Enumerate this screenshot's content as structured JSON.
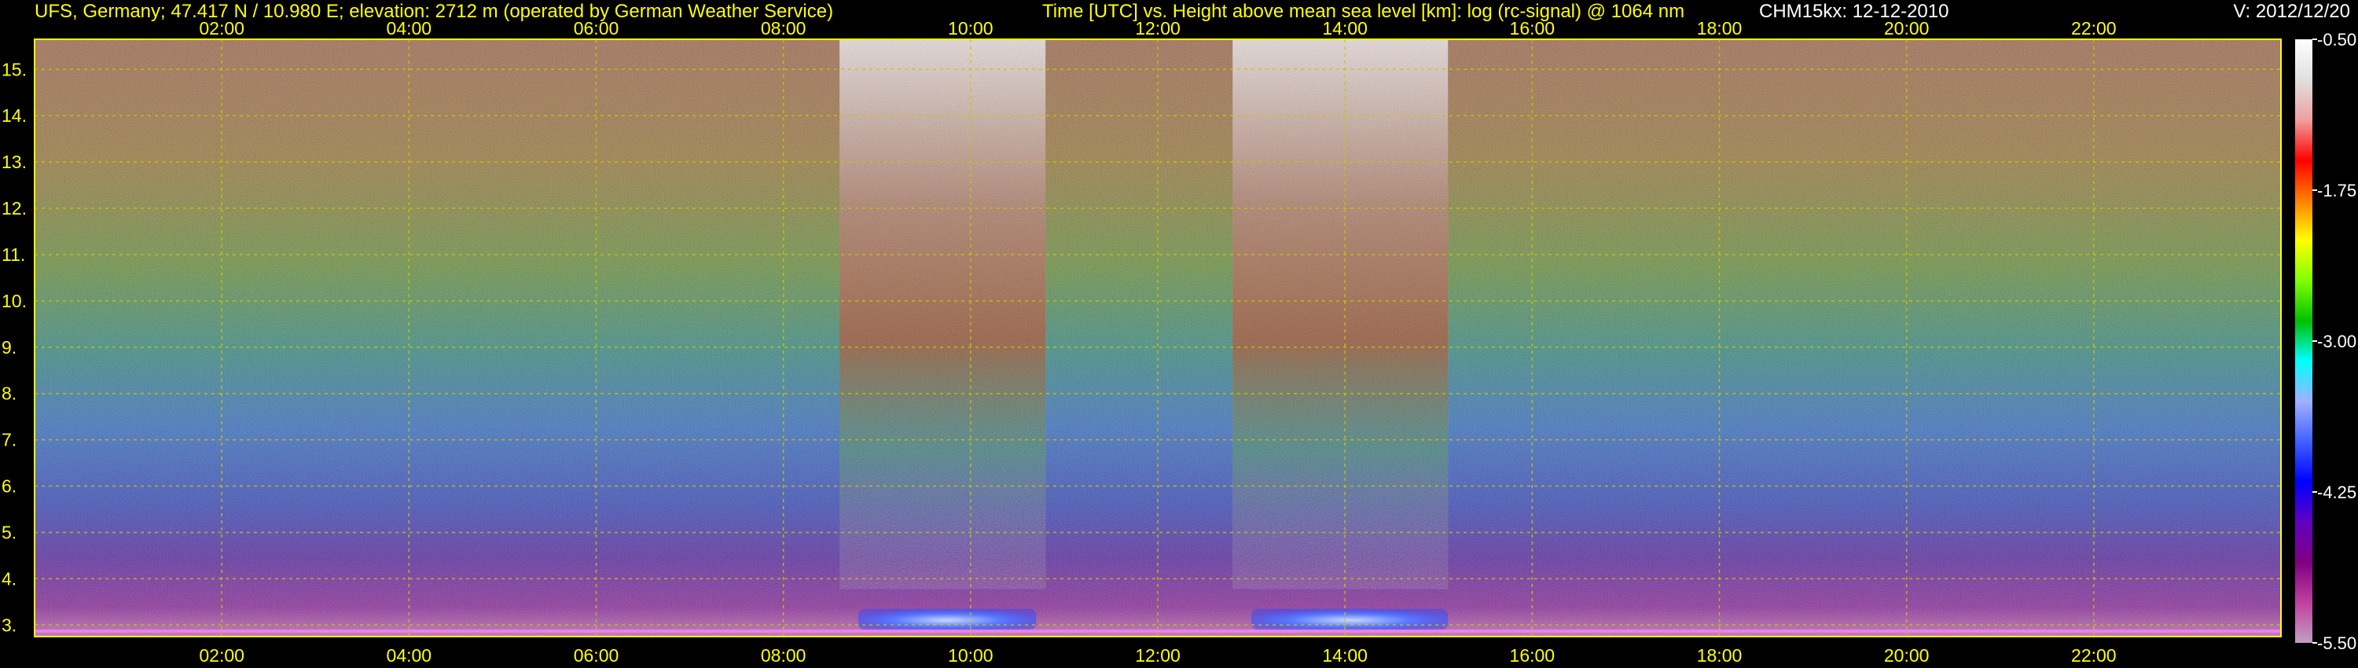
{
  "header": {
    "left": "UFS, Germany; 47.417 N / 10.980 E; elevation: 2712 m  (operated by German Weather Service)",
    "middle": "Time [UTC] vs. Height above mean sea level [km]: log (rc-signal) @ 1064 nm",
    "instrument": "CHM15kx: 12-12-2010",
    "version": "V: 2012/12/20"
  },
  "colors": {
    "text": "#ffff00",
    "grid": "#c8c800",
    "frame": "#ffff00",
    "colorbar_stops": [
      "#ffffff",
      "#e0e0e0",
      "#f0a0a0",
      "#ff0000",
      "#ff8000",
      "#ffff00",
      "#80ff00",
      "#00c000",
      "#00ffff",
      "#a0b0ff",
      "#4060ff",
      "#0000ff",
      "#6000c0",
      "#800080",
      "#c040a0",
      "#c0a0c0"
    ]
  },
  "chart_data": {
    "type": "heatmap",
    "x_ticks": [
      "02:00",
      "04:00",
      "06:00",
      "08:00",
      "10:00",
      "12:00",
      "14:00",
      "16:00",
      "18:00",
      "20:00",
      "22:00"
    ],
    "x_tick_hours": [
      2,
      4,
      6,
      8,
      10,
      12,
      14,
      16,
      18,
      20,
      22
    ],
    "xlim": [
      0,
      24
    ],
    "y_ticks": [
      "3.",
      "4.",
      "5.",
      "6.",
      "7.",
      "8.",
      "9.",
      "10.",
      "11.",
      "12.",
      "13.",
      "14.",
      "15."
    ],
    "y_tick_values": [
      3,
      4,
      5,
      6,
      7,
      8,
      9,
      10,
      11,
      12,
      13,
      14,
      15
    ],
    "ylim": [
      2.75,
      15.65
    ],
    "colorbar_ticks": [
      "-0.50",
      "-1.75",
      "-3.00",
      "-4.25",
      "-5.50"
    ],
    "colorbar_values": [
      -0.5,
      -1.75,
      -3.0,
      -4.25,
      -5.5
    ],
    "colorbar_range": [
      -5.5,
      -0.5
    ],
    "grid": true,
    "features": [
      {
        "kind": "high-signal column",
        "x_range": [
          8.6,
          10.8
        ]
      },
      {
        "kind": "high-signal column",
        "x_range": [
          12.8,
          15.1
        ]
      },
      {
        "kind": "strong low-level return",
        "x_range": [
          8.8,
          10.7
        ],
        "y_range": [
          2.9,
          3.35
        ]
      },
      {
        "kind": "strong low-level return",
        "x_range": [
          13.0,
          15.1
        ],
        "y_range": [
          2.9,
          3.35
        ]
      }
    ]
  }
}
